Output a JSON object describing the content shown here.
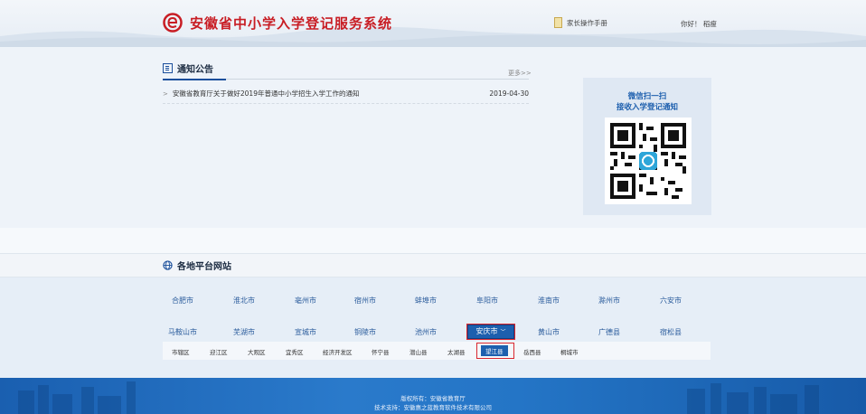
{
  "header": {
    "title": "安徽省中小学入学登记服务系统",
    "manual_label": "家长操作手册",
    "greeting": "你好！ 稻瘦"
  },
  "notice": {
    "heading": "通知公告",
    "more_label": "更多>>",
    "items": [
      {
        "title": "安徽省教育厅关于做好2019年普通中小学招生入学工作的通知",
        "date": "2019-04-30"
      }
    ]
  },
  "wechat": {
    "line1": "微信扫一扫",
    "line2": "接收入学登记通知"
  },
  "platforms": {
    "heading": "各地平台网站",
    "row1": [
      "合肥市",
      "淮北市",
      "亳州市",
      "宿州市",
      "蚌埠市",
      "阜阳市",
      "淮南市",
      "滁州市",
      "六安市"
    ],
    "row2": [
      "马鞍山市",
      "芜湖市",
      "宣城市",
      "铜陵市",
      "池州市",
      "安庆市",
      "黄山市",
      "广德县",
      "宿松县"
    ],
    "selected_city": "安庆市",
    "districts": [
      "市辖区",
      "迎江区",
      "大观区",
      "宜秀区",
      "经济开发区",
      "怀宁县",
      "潜山县",
      "太湖县",
      "望江县",
      "岳西县",
      "桐城市"
    ],
    "selected_district": "望江县"
  },
  "footer": {
    "line1": "版权所有：安徽省教育厅",
    "line2": "技术支持：安徽惠之蓝教育软件技术有限公司"
  },
  "colors": {
    "brand_red": "#c81d24",
    "accent_blue": "#1d5fae",
    "footer_blue": "#2475c6",
    "highlight_red": "#d9272f"
  }
}
